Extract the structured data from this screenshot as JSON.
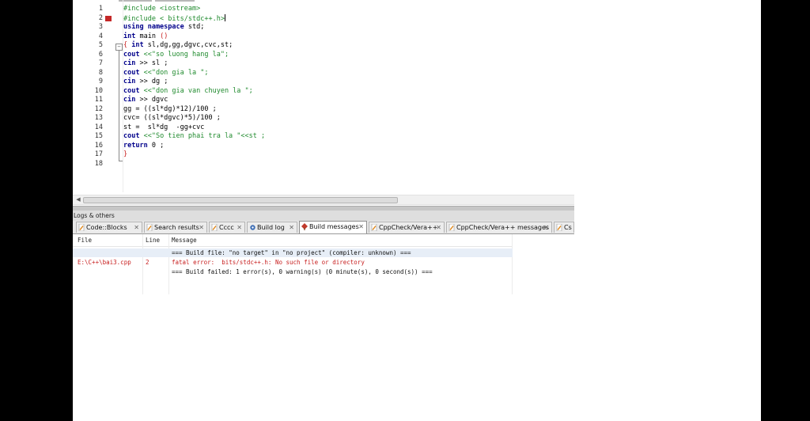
{
  "editor": {
    "line_numbers": [
      "1",
      "2",
      "3",
      "4",
      "5",
      "6",
      "7",
      "8",
      "9",
      "10",
      "11",
      "12",
      "13",
      "14",
      "15",
      "16",
      "17",
      "18"
    ],
    "lines": [
      [
        {
          "t": "#include <iostream>",
          "c": "pp"
        }
      ],
      [
        {
          "t": "#include < bits/stdc++.h>",
          "c": "pp"
        },
        {
          "t": "",
          "c": "caret"
        }
      ],
      [
        {
          "t": "using namespace",
          "c": "kw"
        },
        {
          "t": " std;",
          "c": "tx"
        }
      ],
      [
        {
          "t": "int",
          "c": "kw"
        },
        {
          "t": " main ",
          "c": "tx"
        },
        {
          "t": "()",
          "c": "rd"
        }
      ],
      [
        {
          "t": "{",
          "c": "rd"
        },
        {
          "t": " int",
          "c": "kw"
        },
        {
          "t": " sl,dg,gg,dgvc,cvc,st;",
          "c": "tx"
        }
      ],
      [
        {
          "t": "cout ",
          "c": "kw"
        },
        {
          "t": "<<\"so luong hang la\";",
          "c": "pp"
        }
      ],
      [
        {
          "t": "cin ",
          "c": "kw"
        },
        {
          "t": ">> sl ;",
          "c": "tx"
        }
      ],
      [
        {
          "t": "cout ",
          "c": "kw"
        },
        {
          "t": "<<\"don gia la \";",
          "c": "pp"
        }
      ],
      [
        {
          "t": "cin ",
          "c": "kw"
        },
        {
          "t": ">> dg ;",
          "c": "tx"
        }
      ],
      [
        {
          "t": "cout ",
          "c": "kw"
        },
        {
          "t": "<<\"don gia van chuyen la \";",
          "c": "pp"
        }
      ],
      [
        {
          "t": "cin ",
          "c": "kw"
        },
        {
          "t": ">> dgvc",
          "c": "tx"
        }
      ],
      [
        {
          "t": "gg = ((sl*dg)*12)/100 ;",
          "c": "tx"
        }
      ],
      [
        {
          "t": "cvc= ((sl*dgvc)*5)/100 ;",
          "c": "tx"
        }
      ],
      [
        {
          "t": "st =  sl*dg  -gg+cvc",
          "c": "tx"
        }
      ],
      [
        {
          "t": "cout ",
          "c": "kw"
        },
        {
          "t": "<<\"So tien phai tra la \"<<st ;",
          "c": "pp"
        }
      ],
      [
        {
          "t": "return",
          "c": "kw"
        },
        {
          "t": " 0 ;",
          "c": "tx"
        }
      ],
      [
        {
          "t": "}",
          "c": "rd"
        }
      ],
      []
    ]
  },
  "logs": {
    "title": "Logs & others",
    "tabs": [
      {
        "label": "Code::Blocks",
        "icon": "pencil-icon",
        "active": false
      },
      {
        "label": "Search results",
        "icon": "pencil-icon",
        "active": false
      },
      {
        "label": "Cccc",
        "icon": "pencil-icon",
        "active": false
      },
      {
        "label": "Build log",
        "icon": "gear-icon",
        "active": false
      },
      {
        "label": "Build messages",
        "icon": "diamond-icon",
        "active": true
      },
      {
        "label": "CppCheck/Vera++",
        "icon": "pencil-icon",
        "active": false
      },
      {
        "label": "CppCheck/Vera++ messages",
        "icon": "pencil-icon",
        "active": false
      },
      {
        "label": "Cs",
        "icon": "pencil-icon",
        "active": false
      }
    ],
    "close_glyph": "✕",
    "columns": {
      "file": "File",
      "line": "Line",
      "message": "Message"
    },
    "rows": [
      {
        "file": "",
        "line": "",
        "message": "=== Build file: \"no target\" in \"no project\" (compiler: unknown) ===",
        "type": "info"
      },
      {
        "file": "E:\\C++\\bai3.cpp",
        "line": "2",
        "message": "fatal error:  bits/stdc++.h: No such file or directory",
        "type": "err"
      },
      {
        "file": "",
        "line": "",
        "message": "=== Build failed: 1 error(s), 0 warning(s) (0 minute(s), 0 second(s)) ===",
        "type": "info"
      }
    ]
  },
  "colors": {
    "error": "#c82020",
    "keyword": "#00008b",
    "preprocessor": "#1f8a2d",
    "breakpoint": "#c42727"
  }
}
